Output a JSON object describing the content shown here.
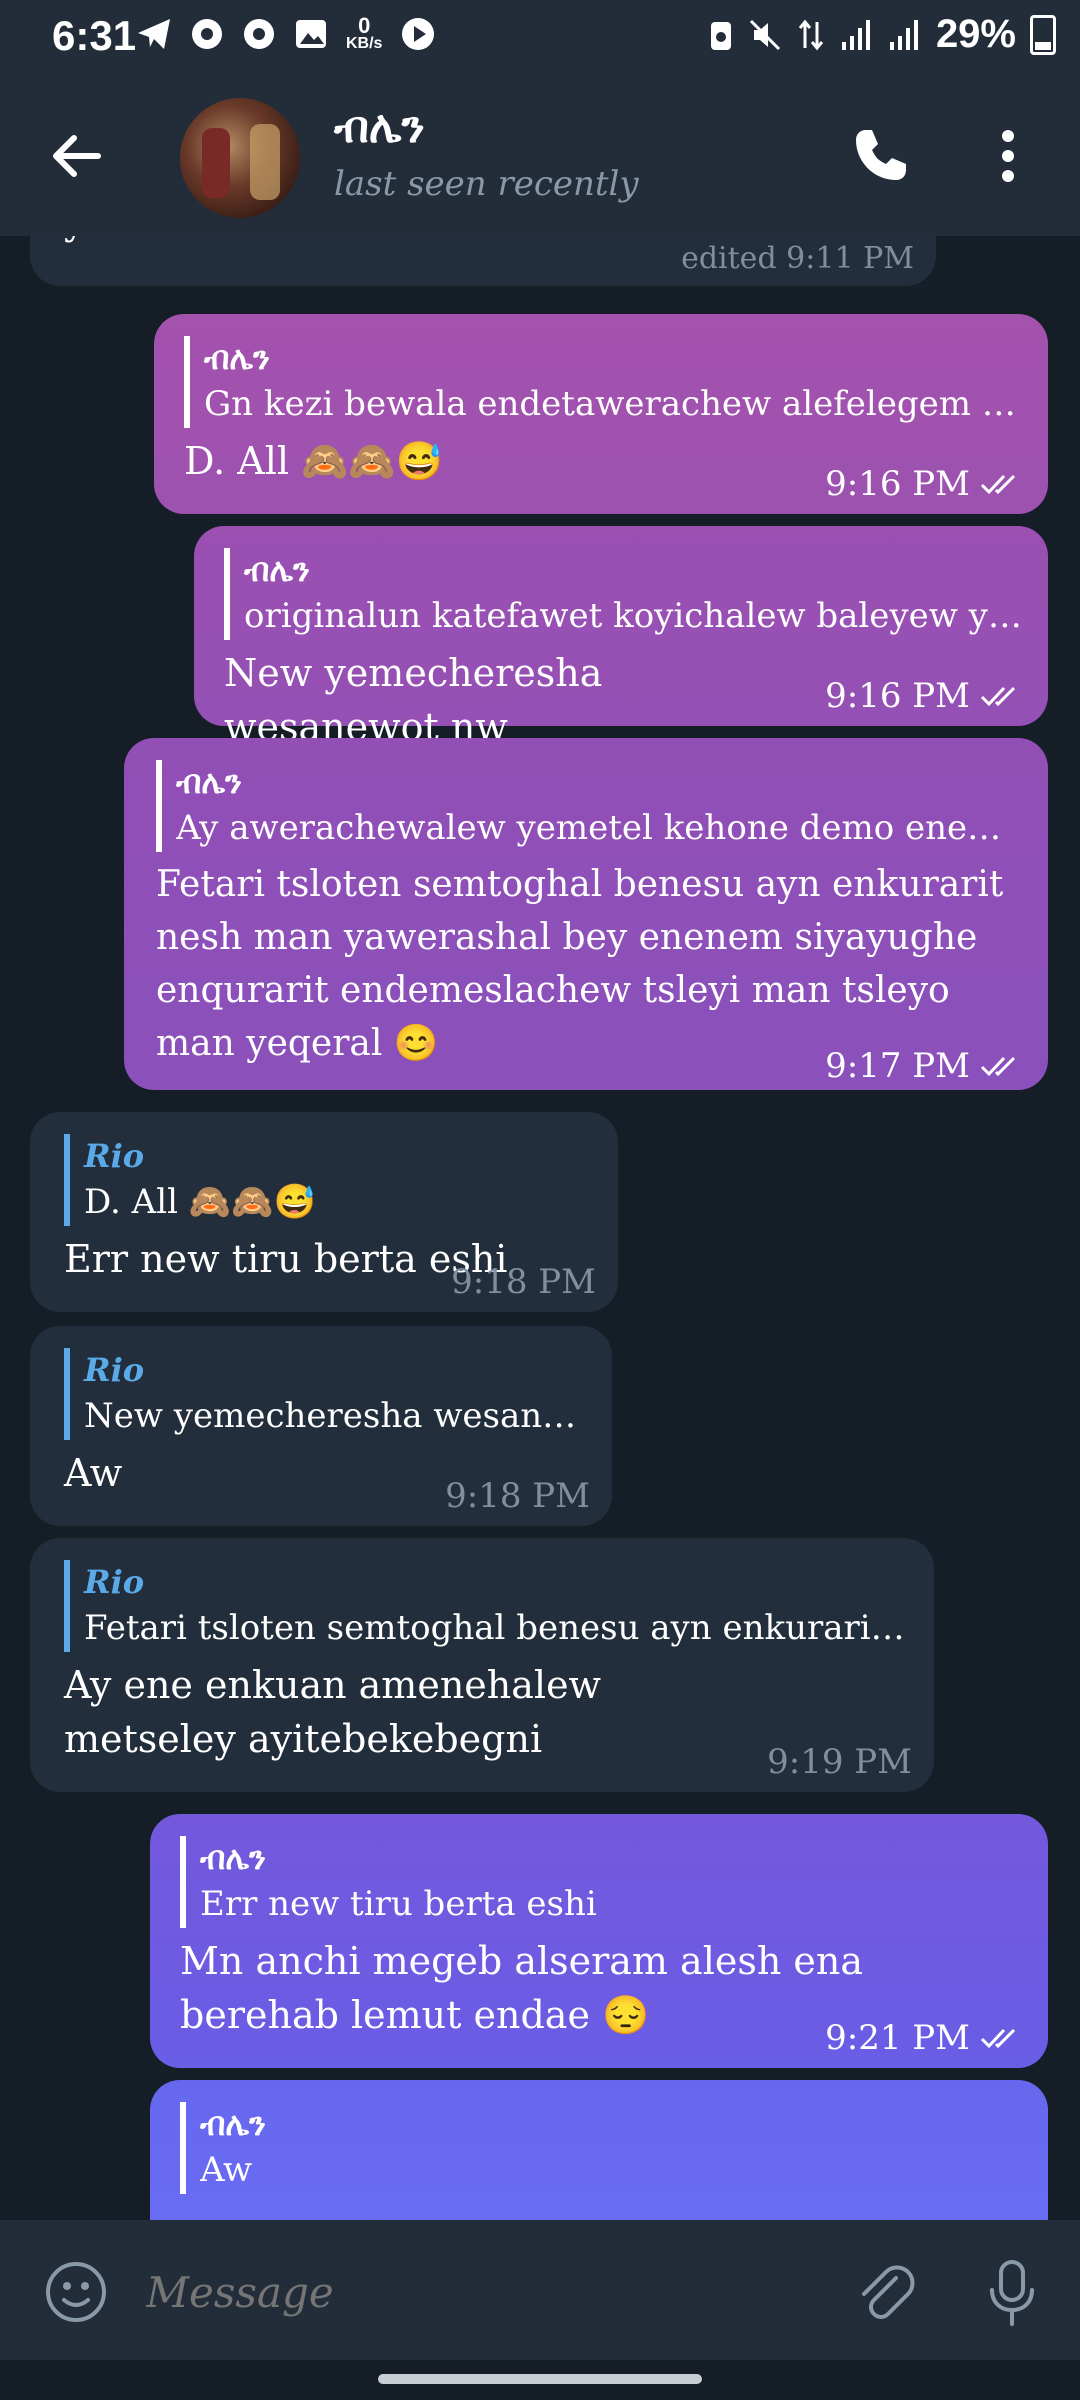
{
  "status_bar": {
    "time": "6:31",
    "net_speed_value": "0",
    "net_speed_unit": "KB/s",
    "battery": "29%",
    "icons": [
      "telegram-icon",
      "chrome-icon",
      "chrome-icon",
      "gallery-icon",
      "kbs-indicator",
      "play-icon",
      "battery-saver-icon",
      "mute-icon",
      "data-arrows-icon",
      "signal-icon",
      "signal-icon",
      "battery-icon"
    ]
  },
  "header": {
    "name": "ብሌን",
    "status": "last seen recently"
  },
  "messages": [
    {
      "id": "m0",
      "direction": "in",
      "text": "yishalehal aa",
      "time": "edited 9:11 PM"
    },
    {
      "id": "m1",
      "direction": "out",
      "quote_author": "ብሌን",
      "quote_text": "Gn kezi bewala endetawerachew alefelegem yemr wey...",
      "text": "D. All 🙈🙈😅",
      "time": "9:16 PM"
    },
    {
      "id": "m2",
      "direction": "out",
      "quote_author": "ብሌን",
      "quote_text": "originalun katefawet koyichalew baleyew yilefeh beqa",
      "text": "New yemecheresha wesanewot nw",
      "time": "9:16 PM"
    },
    {
      "id": "m3",
      "direction": "out",
      "quote_author": "ብሌን",
      "quote_text": "Ay awerachewalew yemetel kehone demo enem baloch...",
      "text": "Fetari tsloten semtoghal benesu ayn enkurarit nesh man yawerashal bey enenem siyayughe enqurarit endemeslachew tsleyi man tsleyo man yeqeral 😊",
      "time": "9:17 PM"
    },
    {
      "id": "m4",
      "direction": "in",
      "quote_author": "Rio",
      "quote_text": "D. All 🙈🙈😅",
      "text": "Err new tiru berta eshi",
      "time": "9:18 PM"
    },
    {
      "id": "m5",
      "direction": "in",
      "quote_author": "Rio",
      "quote_text": "New yemecheresha wesanewot nw",
      "text": "Aw",
      "time": "9:18 PM"
    },
    {
      "id": "m6",
      "direction": "in",
      "quote_author": "Rio",
      "quote_text": "Fetari tsloten semtoghal benesu ayn enkurarit nesh m...",
      "text": "Ay ene enkuan amenehalew metseley ayitebekebegni",
      "time": "9:19 PM"
    },
    {
      "id": "m7",
      "direction": "out",
      "quote_author": "ብሌን",
      "quote_text": "Err new tiru berta eshi",
      "text": "Mn anchi megeb alseram alesh ena berehab lemut endae 😔",
      "time": "9:21 PM"
    },
    {
      "id": "m8",
      "direction": "out",
      "quote_author": "ብሌን",
      "quote_text": "Aw",
      "text": "",
      "time": ""
    }
  ],
  "composer": {
    "placeholder": "Message"
  },
  "colors": {
    "background": "#151d26",
    "bar": "#222d39",
    "incoming_bubble": "#222e3b",
    "quote_accent_in": "#5aa9e8",
    "out_gradient_top": "#a150a8",
    "out_gradient_bottom": "#6c6cf2"
  }
}
